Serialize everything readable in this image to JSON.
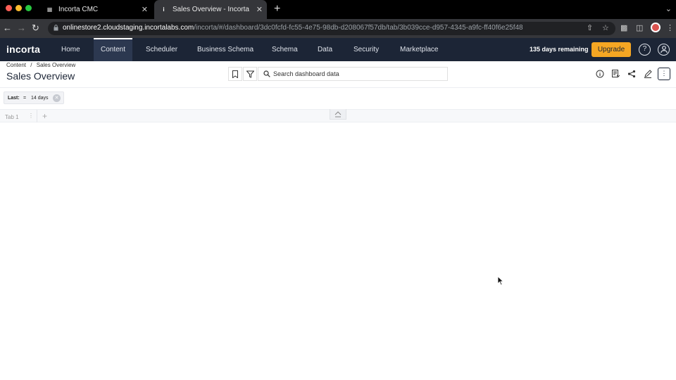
{
  "browser": {
    "tabs": [
      {
        "title": "Incorta CMC",
        "active": false
      },
      {
        "title": "Sales Overview - Incorta",
        "active": true
      }
    ],
    "url_host": "onlinestore2.cloudstaging.incortalabs.com",
    "url_path": "/incorta/#/dashboard/3dc0fcfd-fc55-4e75-98db-d208067f57db/tab/3b039cce-d957-4345-a9fc-ff40f6e25f48"
  },
  "app": {
    "logo": "incorta",
    "nav": [
      "Home",
      "Content",
      "Scheduler",
      "Business Schema",
      "Schema",
      "Data",
      "Security",
      "Marketplace"
    ],
    "active_nav": "Content",
    "days_remaining": "135 days remaining",
    "upgrade_label": "Upgrade"
  },
  "dashboard": {
    "breadcrumb_root": "Content",
    "breadcrumb_sep": "/",
    "breadcrumb_current": "Sales Overview",
    "title": "Sales Overview",
    "search_placeholder": "Search dashboard data",
    "filter": {
      "key": "Last:",
      "operator": "=",
      "value": "14 days"
    },
    "tabs": [
      "Tab 1"
    ]
  },
  "colors": {
    "header_bg": "#1c2536",
    "accent": "#f5a623"
  }
}
